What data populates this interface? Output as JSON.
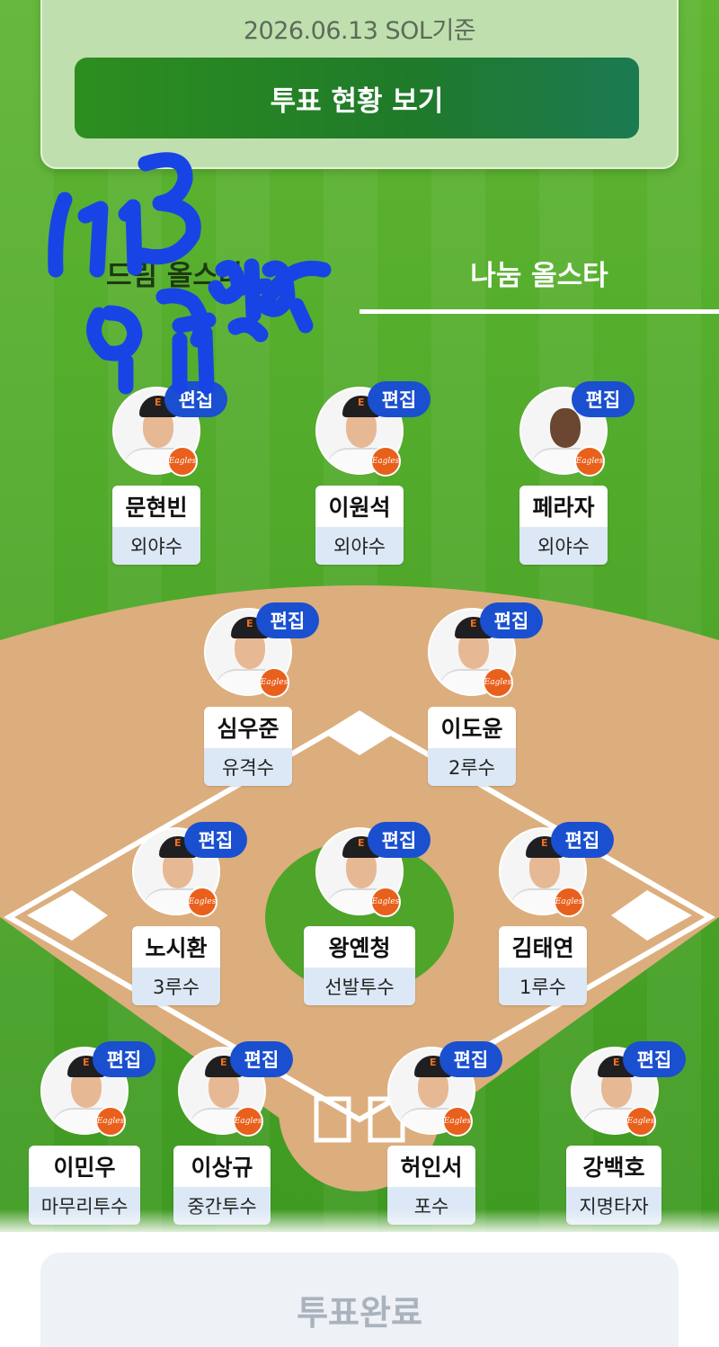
{
  "header": {
    "date_text": "2026.06.13 SOL기준",
    "vote_status_label": "투표 현황 보기"
  },
  "tabs": {
    "left_label": "드림 올스타",
    "right_label": "나눔 올스타"
  },
  "edit_label": "편집",
  "team_badge": "Eagles",
  "players": {
    "p1": {
      "name": "문현빈",
      "position": "외야수"
    },
    "p2": {
      "name": "이원석",
      "position": "외야수"
    },
    "p3": {
      "name": "페라자",
      "position": "외야수"
    },
    "p4": {
      "name": "심우준",
      "position": "유격수"
    },
    "p5": {
      "name": "이도윤",
      "position": "2루수"
    },
    "p6": {
      "name": "노시환",
      "position": "3루수"
    },
    "p7": {
      "name": "왕옌청",
      "position": "선발투수"
    },
    "p8": {
      "name": "김태연",
      "position": "1루수"
    },
    "p9": {
      "name": "이민우",
      "position": "마무리투수"
    },
    "p10": {
      "name": "이상규",
      "position": "중간투수"
    },
    "p11": {
      "name": "허인서",
      "position": "포수"
    },
    "p12": {
      "name": "강백호",
      "position": "지명타자"
    }
  },
  "handwriting": "6/13 올스타",
  "footer": {
    "vote_done_label": "투표완료"
  },
  "colors": {
    "grass": "#4fa52a",
    "infield_dirt": "#dcae7d",
    "edit_button": "#1a4fd0",
    "position_bg": "#dce8f5",
    "scribble": "#1844e6"
  }
}
